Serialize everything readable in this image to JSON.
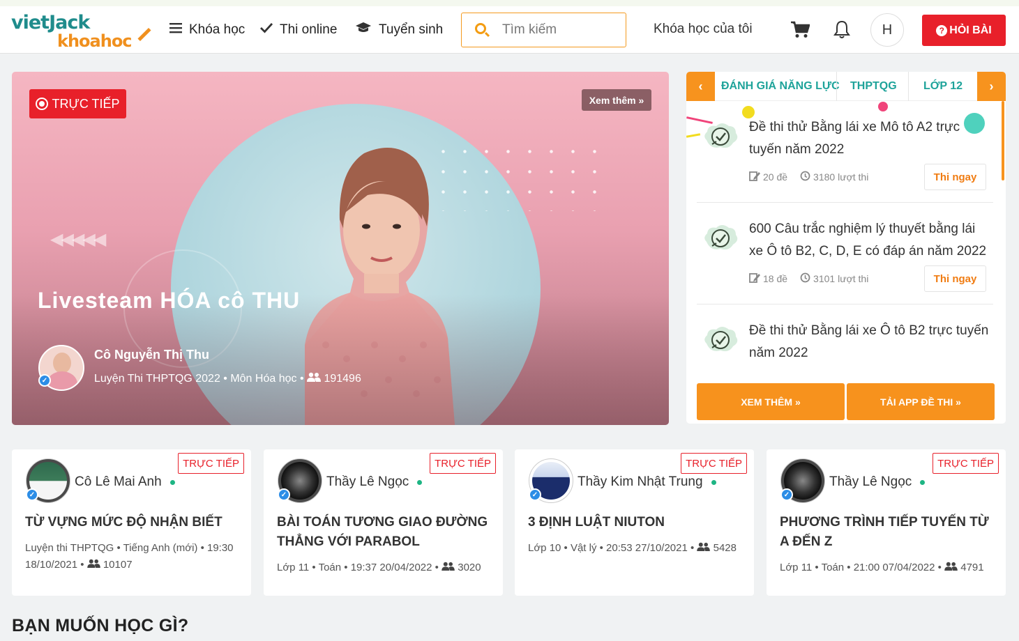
{
  "header": {
    "logo_top": "vietJack",
    "logo_bottom": "khoahoc",
    "nav": [
      {
        "label": "Khóa học",
        "icon": "menu-icon"
      },
      {
        "label": "Thi online",
        "icon": "check-icon"
      },
      {
        "label": "Tuyển sinh",
        "icon": "graduation-cap-icon"
      }
    ],
    "search_placeholder": "Tìm kiếm",
    "my_courses": "Khóa học của tôi",
    "avatar_initial": "H",
    "ask_button": "HỎI BÀI",
    "accent_color": "#f7931e",
    "red_color": "#e8202a"
  },
  "banner": {
    "live_label": "TRỰC TIẾP",
    "more_label": "Xem thêm »",
    "title": "Livesteam HÓA cô THU",
    "teacher_name": "Cô Nguyễn Thị Thu",
    "meta": "Luyện Thi THPTQG 2022 • Môn Hóa học •",
    "viewers": "191496"
  },
  "exam_panel": {
    "tabs": [
      "ĐÁNH GIÁ NĂNG LỰC",
      "THPTQG",
      "LỚP 12"
    ],
    "items": [
      {
        "title": "Đề thi thử Bằng lái xe Mô tô A2 trực tuyến năm 2022",
        "tests": "20 đề",
        "attempts": "3180 lượt thi",
        "button": "Thi ngay"
      },
      {
        "title": "600 Câu trắc nghiệm lý thuyết bằng lái xe Ô tô B2, C, D, E có đáp án năm 2022",
        "tests": "18 đề",
        "attempts": "3101 lượt thi",
        "button": "Thi ngay"
      },
      {
        "title": "Đề thi thử Bằng lái xe Ô tô B2 trực tuyến năm 2022",
        "tests": "",
        "attempts": "",
        "button": ""
      }
    ],
    "more_button": "XEM THÊM »",
    "app_button": "TẢI APP ĐỀ THI »"
  },
  "live_cards": [
    {
      "teacher": "Cô Lê Mai Anh",
      "tag": "TRỰC TIẾP",
      "title": "TỪ VỰNG MỨC ĐỘ NHẬN BIẾT",
      "meta": "Luyện thi THPTQG • Tiếng Anh (mới) • 19:30 18/10/2021 •",
      "viewers": "10107"
    },
    {
      "teacher": "Thầy Lê Ngọc",
      "tag": "TRỰC TIẾP",
      "title": "BÀI TOÁN TƯƠNG GIAO ĐƯỜNG THẲNG VỚI PARABOL",
      "meta": "Lớp 11 • Toán • 19:37 20/04/2022 •",
      "viewers": "3020"
    },
    {
      "teacher": "Thầy Kim Nhật Trung",
      "tag": "TRỰC TIẾP",
      "title": "3 ĐỊNH LUẬT NIUTON",
      "meta": "Lớp 10 • Vật lý • 20:53 27/10/2021 •",
      "viewers": "5428"
    },
    {
      "teacher": "Thầy Lê Ngọc",
      "tag": "TRỰC TIẾP",
      "title": "PHƯƠNG TRÌNH TIẾP TUYẾN TỪ A ĐẾN Z",
      "meta": "Lớp 11 • Toán • 21:00 07/04/2022 •",
      "viewers": "4791"
    }
  ],
  "section_title": "BẠN MUỐN HỌC GÌ?"
}
